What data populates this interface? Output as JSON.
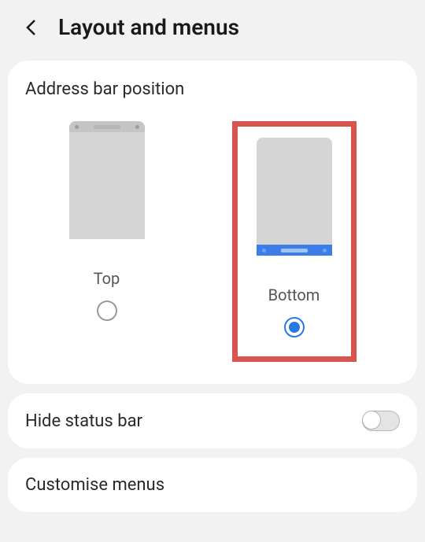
{
  "header": {
    "title": "Layout and menus"
  },
  "address_bar": {
    "section_title": "Address bar position",
    "options": {
      "top": {
        "label": "Top"
      },
      "bottom": {
        "label": "Bottom"
      }
    }
  },
  "rows": {
    "hide_status_bar": {
      "label": "Hide status bar"
    },
    "customise_menus": {
      "label": "Customise menus"
    }
  }
}
